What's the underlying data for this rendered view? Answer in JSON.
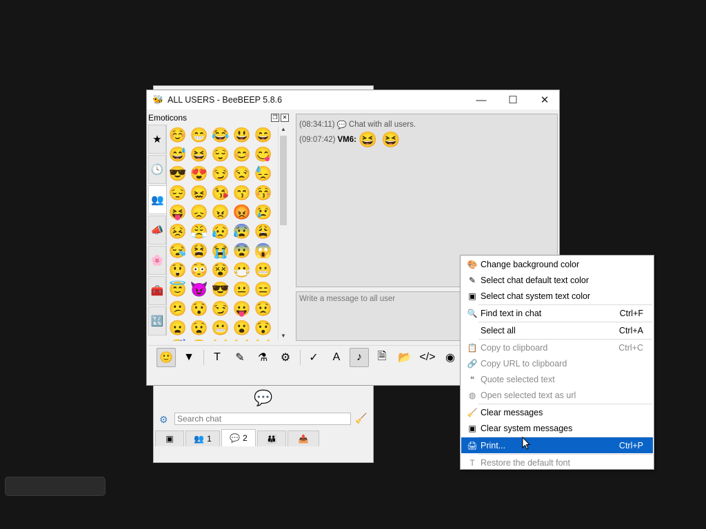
{
  "window": {
    "title": "ALL USERS - BeeBEEP 5.8.6",
    "icon": "beebeep-app-icon",
    "controls": {
      "minimize": "—",
      "maximize": "☐",
      "close": "✕"
    }
  },
  "emoticons": {
    "title": "Emoticons",
    "float_button": "❐",
    "close_button": "✕",
    "categories": [
      {
        "icon": "star-icon",
        "glyph": "★"
      },
      {
        "icon": "clock-icon",
        "glyph": "🕓"
      },
      {
        "icon": "people-icon",
        "glyph": "👥"
      },
      {
        "icon": "megaphone-icon",
        "glyph": "📣"
      },
      {
        "icon": "flower-icon",
        "glyph": "🌸"
      },
      {
        "icon": "objects-icon",
        "glyph": "🧰"
      },
      {
        "icon": "symbols-icon",
        "glyph": "🔣"
      }
    ],
    "grid": [
      [
        "☺️",
        "😁",
        "😂",
        "😃",
        "😄"
      ],
      [
        "😅",
        "😆",
        "😌",
        "😊",
        "😋"
      ],
      [
        "😎",
        "😍",
        "😏",
        "😒",
        "😓"
      ],
      [
        "😔",
        "😖",
        "😘",
        "😙",
        "😚"
      ],
      [
        "😝",
        "😞",
        "😠",
        "😡",
        "😢"
      ],
      [
        "😣",
        "😤",
        "😥",
        "😰",
        "😩"
      ],
      [
        "😪",
        "😫",
        "😭",
        "😨",
        "😱"
      ],
      [
        "😲",
        "😳",
        "😵",
        "😷",
        "😬"
      ],
      [
        "😇",
        "😈",
        "😎",
        "😐",
        "😑"
      ],
      [
        "😕",
        "😯",
        "😏",
        "😛",
        "😟"
      ],
      [
        "😦",
        "😧",
        "😬",
        "😮",
        "😯"
      ],
      [
        "😴",
        "😶",
        "😸",
        "😹",
        "😼"
      ]
    ]
  },
  "chat": {
    "messages": [
      {
        "time": "(08:34:11)",
        "icon": "chat-bubble-icon",
        "glyph": "💬",
        "text": "Chat with all users."
      },
      {
        "time": "(09:07:42)",
        "nick": "VM6:",
        "emojis": "😆 😆"
      }
    ],
    "input_placeholder": "Write a message to all user"
  },
  "toolbar": [
    {
      "name": "emoticons-button",
      "glyph": "🙂",
      "pressed": true
    },
    {
      "name": "send-button",
      "glyph": "▼"
    },
    {
      "sep": true
    },
    {
      "name": "font-button",
      "glyph": "T"
    },
    {
      "name": "color-button",
      "glyph": "✎"
    },
    {
      "name": "filter-button",
      "glyph": "⚗"
    },
    {
      "name": "settings-button",
      "glyph": "⚙"
    },
    {
      "sep": true
    },
    {
      "name": "spellcheck-button",
      "glyph": "✓"
    },
    {
      "name": "completer-button",
      "glyph": "A"
    },
    {
      "name": "sound-button",
      "glyph": "♪",
      "pressed": true
    },
    {
      "name": "save-chat-button",
      "glyph": "🗎"
    },
    {
      "name": "send-file-button",
      "glyph": "📂"
    },
    {
      "name": "html-button",
      "glyph": "</>"
    },
    {
      "name": "screenshot-button",
      "glyph": "◉"
    }
  ],
  "context_menu": {
    "items": [
      {
        "icon": "background-color-icon",
        "glyph": "🎨",
        "label": "Change background color",
        "shortcut": "",
        "disabled": false
      },
      {
        "icon": "text-color-icon",
        "glyph": "✎",
        "label": "Select chat default text color",
        "shortcut": "",
        "disabled": false
      },
      {
        "icon": "system-color-icon",
        "glyph": "▣",
        "label": "Select chat system text color",
        "shortcut": "",
        "disabled": false
      },
      {
        "sep": true
      },
      {
        "icon": "find-icon",
        "glyph": "🔍",
        "label": "Find text in chat",
        "shortcut": "Ctrl+F",
        "disabled": false
      },
      {
        "sep": true
      },
      {
        "icon": "",
        "glyph": "",
        "label": "Select all",
        "shortcut": "Ctrl+A",
        "disabled": false
      },
      {
        "sep": true
      },
      {
        "icon": "clipboard-icon",
        "glyph": "📋",
        "label": "Copy to clipboard",
        "shortcut": "Ctrl+C",
        "disabled": true
      },
      {
        "icon": "url-icon",
        "glyph": "🔗",
        "label": "Copy URL to clipboard",
        "shortcut": "",
        "disabled": true
      },
      {
        "icon": "quote-icon",
        "glyph": "❝",
        "label": "Quote selected text",
        "shortcut": "",
        "disabled": true
      },
      {
        "icon": "open-url-icon",
        "glyph": "◍",
        "label": "Open selected text as url",
        "shortcut": "",
        "disabled": true
      },
      {
        "sep": true
      },
      {
        "icon": "broom-icon",
        "glyph": "🧹",
        "label": "Clear messages",
        "shortcut": "",
        "disabled": false
      },
      {
        "icon": "clear-system-icon",
        "glyph": "▣",
        "label": "Clear system messages",
        "shortcut": "",
        "disabled": false
      },
      {
        "sep": true
      },
      {
        "icon": "print-icon",
        "glyph": "🖨",
        "label": "Print...",
        "shortcut": "Ctrl+P",
        "disabled": false,
        "highlighted": true
      },
      {
        "sep": true
      },
      {
        "icon": "font-icon",
        "glyph": "T",
        "label": "Restore the default font",
        "shortcut": "",
        "disabled": true
      }
    ]
  },
  "background_window": {
    "chat_icon": "💬",
    "search_placeholder": "Search chat",
    "search_icon": "⚙",
    "clear_icon": "🧹",
    "tabs": [
      {
        "icon": "user-list-icon",
        "glyph": "▣",
        "count": ""
      },
      {
        "icon": "users-icon",
        "glyph": "👥",
        "count": "1"
      },
      {
        "icon": "chats-icon",
        "glyph": "💬",
        "count": "2",
        "active": true
      },
      {
        "icon": "groups-icon",
        "glyph": "👪",
        "count": ""
      },
      {
        "icon": "shares-icon",
        "glyph": "📤",
        "count": ""
      }
    ]
  },
  "colors": {
    "desktop": "#151515",
    "menu_highlight": "#0a64c8",
    "chat_background": "#e1e1e1"
  }
}
